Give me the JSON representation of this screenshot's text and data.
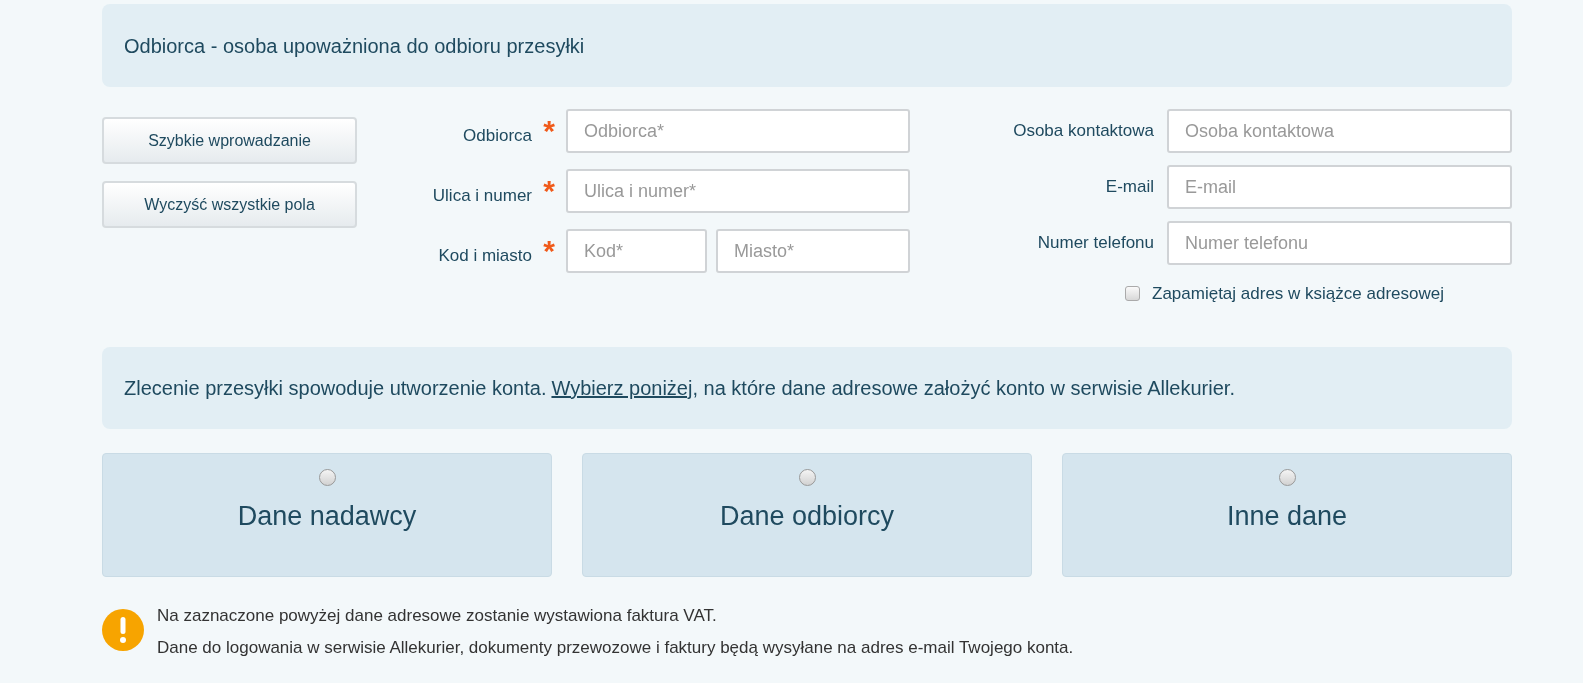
{
  "header": {
    "title": "Odbiorca - osoba upoważniona do odbioru przesyłki"
  },
  "buttons": [
    "Szybkie wprowadzanie",
    "Wyczyść wszystkie pola"
  ],
  "recipient_fields": [
    {
      "label": "Odbiorca",
      "required_mark": "*",
      "inputs": [
        {
          "placeholder": "Odbiorca*"
        }
      ]
    },
    {
      "label": "Ulica i numer",
      "required_mark": "*",
      "inputs": [
        {
          "placeholder": "Ulica i numer*"
        }
      ]
    },
    {
      "label": "Kod i miasto",
      "required_mark": "*",
      "inputs": [
        {
          "placeholder": "Kod*"
        },
        {
          "placeholder": "Miasto*"
        }
      ]
    }
  ],
  "contact_fields": [
    {
      "label": "Osoba kontaktowa",
      "placeholder": "Osoba kontaktowa"
    },
    {
      "label": "E-mail",
      "placeholder": "E-mail"
    },
    {
      "label": "Numer telefonu",
      "placeholder": "Numer telefonu"
    }
  ],
  "remember_checkbox": {
    "label": "Zapamiętaj adres w książce adresowej",
    "checked": false
  },
  "account_banner": {
    "before": "Zlecenie przesyłki spowoduje utworzenie konta.",
    "link": "Wybierz poniżej",
    "after": ", na które dane adresowe założyć konto w serwisie Allekurier."
  },
  "account_options": [
    {
      "label": "Dane nadawcy",
      "selected": false
    },
    {
      "label": "Dane odbiorcy",
      "selected": false
    },
    {
      "label": "Inne dane",
      "selected": false
    }
  ],
  "notice": {
    "lines": [
      "Na zaznaczone powyżej dane adresowe zostanie wystawiona faktura VAT.",
      "Dane do logowania w serwisie Allekurier, dokumenty przewozowe i faktury będą wysyłane na adres e-mail Twojego konta."
    ]
  }
}
